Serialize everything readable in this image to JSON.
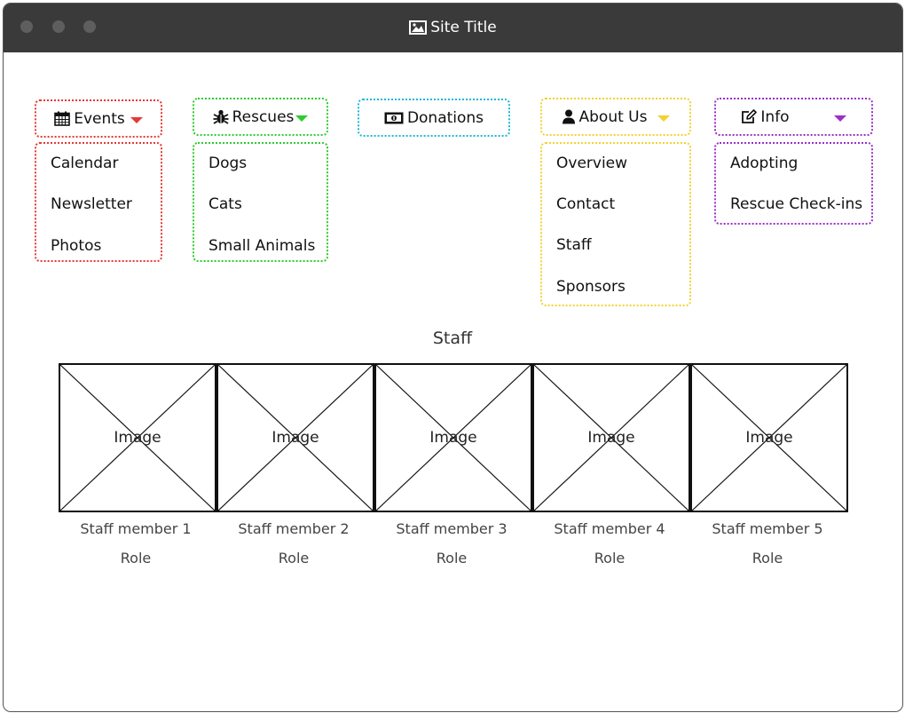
{
  "window": {
    "title": "Site Title"
  },
  "nav": [
    {
      "label": "Events",
      "icon": "calendar-icon",
      "color": "#e53935",
      "items": [
        "Calendar",
        "Newsletter",
        "Photos"
      ]
    },
    {
      "label": "Rescues",
      "icon": "bug-icon",
      "color": "#2ecc2e",
      "items": [
        "Dogs",
        "Cats",
        "Small Animals"
      ]
    },
    {
      "label": "Donations",
      "icon": "money-icon",
      "color": "#1bb8d6",
      "items": []
    },
    {
      "label": "About Us",
      "icon": "user-icon",
      "color": "#f2d230",
      "items": [
        "Overview",
        "Contact",
        "Staff",
        "Sponsors"
      ]
    },
    {
      "label": "Info",
      "icon": "edit-icon",
      "color": "#9b30c9",
      "items": [
        "Adopting",
        "Rescue Check-ins"
      ]
    }
  ],
  "staff": {
    "title": "Staff",
    "image_label": "Image",
    "members": [
      {
        "name": "Staff member 1",
        "role": "Role"
      },
      {
        "name": "Staff member 2",
        "role": "Role"
      },
      {
        "name": "Staff member 3",
        "role": "Role"
      },
      {
        "name": "Staff member 4",
        "role": "Role"
      },
      {
        "name": "Staff member 5",
        "role": "Role"
      }
    ]
  }
}
